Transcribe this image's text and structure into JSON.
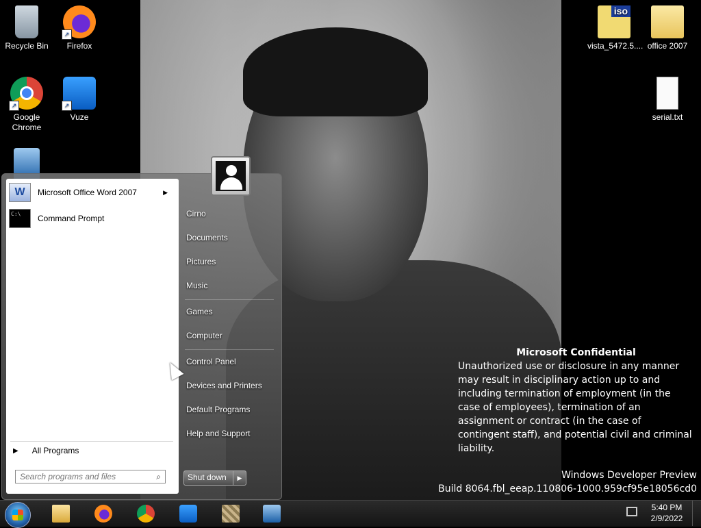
{
  "desktop": {
    "left_icons": [
      {
        "label": "Recycle Bin",
        "icon": "recycle-bin-icon"
      },
      {
        "label": "Firefox",
        "icon": "firefox-icon"
      },
      {
        "label": "Google Chrome",
        "icon": "chrome-icon"
      },
      {
        "label": "Vuze",
        "icon": "vuze-icon"
      },
      {
        "label": "",
        "icon": "virtualbox-icon"
      }
    ],
    "right_icons": [
      {
        "label": "vista_5472.5....",
        "icon": "iso-file-icon",
        "badge": "iso"
      },
      {
        "label": "office 2007",
        "icon": "folder-icon"
      },
      {
        "label": "serial.txt",
        "icon": "text-file-icon"
      }
    ]
  },
  "watermark": {
    "title": "Microsoft Confidential",
    "body": "Unauthorized use or disclosure in any manner may result in disciplinary action up to and including termination of employment (in the case of employees), termination of an assignment or contract (in the case of contingent staff), and potential civil and criminal liability.",
    "build_line1": "Windows Developer Preview",
    "build_line2": "Build 8064.fbl_eeap.110806-1000.959cf95e18056cd0"
  },
  "start_menu": {
    "pinned_programs": [
      {
        "label": "Microsoft Office Word 2007",
        "has_submenu": true
      },
      {
        "label": "Command Prompt",
        "has_submenu": false
      }
    ],
    "all_programs": "All Programs",
    "search_placeholder": "Search programs and files",
    "right_items": [
      "Cirno",
      "Documents",
      "Pictures",
      "Music",
      "Games",
      "Computer",
      "Control Panel",
      "Devices and Printers",
      "Default Programs",
      "Help and Support"
    ],
    "shutdown_label": "Shut down"
  },
  "taskbar": {
    "pinned": [
      "windows-explorer-icon",
      "firefox-icon",
      "chrome-icon",
      "vuze-icon",
      "winrar-icon",
      "virtualbox-icon"
    ],
    "time": "5:40 PM",
    "date": "2/9/2022"
  }
}
